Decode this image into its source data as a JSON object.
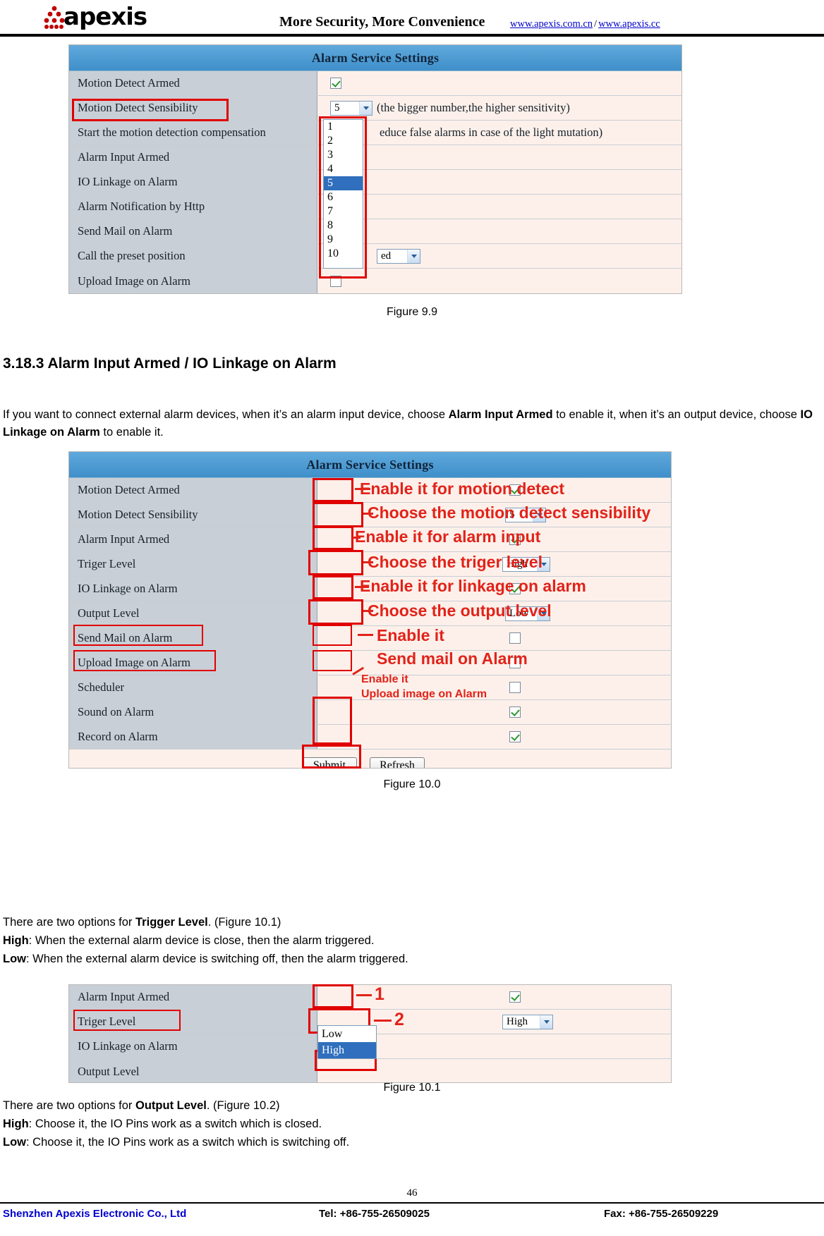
{
  "header": {
    "logo_text": "apexis",
    "tagline": "More Security, More Convenience",
    "link1": "www.apexis.com.cn",
    "separator": "/",
    "link2": "www.apexis.cc"
  },
  "figure_99": {
    "title": "Alarm Service Settings",
    "rows": [
      {
        "label": "Motion Detect Armed",
        "control": "checkbox-checked"
      },
      {
        "label": "Motion Detect Sensibility",
        "control": "select",
        "value": "5",
        "note": "(the bigger number,the higher sensitivity)"
      },
      {
        "label": "Start the motion detection compensation",
        "control": "none",
        "note": "educe false alarms in case of the light mutation)"
      },
      {
        "label": "Alarm Input Armed",
        "control": "none"
      },
      {
        "label": "IO Linkage on Alarm",
        "control": "none"
      },
      {
        "label": "Alarm Notification by Http",
        "control": "none"
      },
      {
        "label": "Send Mail on Alarm",
        "control": "none"
      },
      {
        "label": "Call the preset position",
        "control": "select-partial",
        "value": "ed"
      },
      {
        "label": "Upload Image on Alarm",
        "control": "checkbox"
      }
    ],
    "dropdown_options": [
      "1",
      "2",
      "3",
      "4",
      "5",
      "6",
      "7",
      "8",
      "9",
      "10"
    ],
    "dropdown_selected": "5",
    "caption": "Figure 9.9"
  },
  "section": {
    "heading": "3.18.3 Alarm Input Armed / IO Linkage on Alarm",
    "intro_part1": "If you want to connect external alarm devices, when it’s an alarm input device, choose ",
    "intro_bold1": "Alarm Input Armed",
    "intro_part2": " to enable it, when it’s an output device, choose ",
    "intro_bold2": "IO Linkage on Alarm",
    "intro_part3": " to enable it."
  },
  "figure_100": {
    "title": "Alarm Service Settings",
    "rows": [
      {
        "label": "Motion Detect Armed",
        "control": "checkbox-checked",
        "annotation": "Enable it for motion detect"
      },
      {
        "label": "Motion Detect Sensibility",
        "control": "select",
        "value": "5",
        "annotation": "Choose the motion detect sensibility"
      },
      {
        "label": "Alarm Input Armed",
        "control": "checkbox-checked",
        "annotation": "Enable it for alarm input"
      },
      {
        "label": "Triger Level",
        "control": "select",
        "value": "High",
        "annotation": "Choose the triger level"
      },
      {
        "label": "IO Linkage on Alarm",
        "control": "checkbox-checked",
        "annotation": "Enable it for linkage on alarm"
      },
      {
        "label": "Output Level",
        "control": "select",
        "value": "Low",
        "annotation": "Choose the output level"
      },
      {
        "label": "Send Mail on Alarm",
        "control": "checkbox",
        "annotation": "Enable it"
      },
      {
        "label": "Upload Image on Alarm",
        "control": "checkbox",
        "annotation": "Send mail on Alarm"
      },
      {
        "label": "Scheduler",
        "control": "checkbox",
        "annotation": "Enable it"
      },
      {
        "label": "Sound on Alarm",
        "control": "checkbox-checked",
        "annotation": "Upload image on Alarm"
      },
      {
        "label": "Record on Alarm",
        "control": "checkbox-checked"
      }
    ],
    "submit_label": "Submit",
    "refresh_label": "Refresh",
    "caption": "Figure 10.0"
  },
  "trigger_text": {
    "line1_part1": "There are two options for ",
    "line1_bold": "Trigger Level",
    "line1_part2": ". (Figure 10.1)",
    "line2_bold": "High",
    "line2_rest": ": When the external alarm device is close, then the alarm triggered.",
    "line3_bold": "Low",
    "line3_rest": ": When the external alarm device is switching off, then the alarm triggered."
  },
  "figure_101": {
    "rows": [
      {
        "label": "Alarm Input Armed",
        "control": "checkbox-checked",
        "annotation": "1"
      },
      {
        "label": "Triger Level",
        "control": "select",
        "value": "High",
        "annotation": "2"
      },
      {
        "label": "IO Linkage on Alarm",
        "control": "none"
      },
      {
        "label": "Output Level",
        "control": "none"
      }
    ],
    "dropdown_options": [
      "Low",
      "High"
    ],
    "dropdown_selected": "High",
    "caption": "Figure 10.1"
  },
  "output_text": {
    "line1_part1": "There are two options for ",
    "line1_bold": "Output Level",
    "line1_part2": ". (Figure 10.2)",
    "line2_bold": "High",
    "line2_rest": ": Choose it, the IO Pins work as a switch which is closed.",
    "line3_bold": "Low",
    "line3_rest": ": Choose it, the IO Pins work as a switch which is switching off."
  },
  "footer": {
    "page_number": "46",
    "company": "Shenzhen Apexis Electronic Co., Ltd",
    "tel": "Tel: +86-755-26509025",
    "fax": "Fax: +86-755-26509229"
  }
}
